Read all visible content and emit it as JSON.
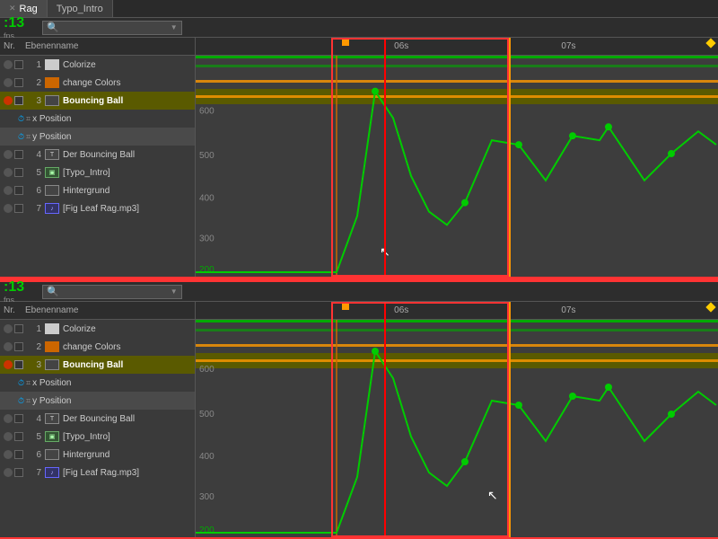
{
  "tabs": [
    {
      "id": "rag",
      "label": "Rag",
      "active": true
    },
    {
      "id": "typo_intro",
      "label": "Typo_Intro",
      "active": false
    }
  ],
  "panel1": {
    "time": ":13",
    "fps": "fps",
    "search_placeholder": "🔍",
    "header": {
      "nr": "Nr.",
      "name": "Ebenenname"
    },
    "layers": [
      {
        "nr": "1",
        "name": "Colorize",
        "icon": "white",
        "selected": false
      },
      {
        "nr": "2",
        "name": "change Colors",
        "icon": "orange",
        "selected": false
      },
      {
        "nr": "3",
        "name": "Bouncing Ball",
        "icon": "dark",
        "selected": true,
        "highlighted": true
      },
      {
        "sub": true,
        "icon": "stopwatch",
        "transform": "x Position"
      },
      {
        "sub": true,
        "icon": "stopwatch",
        "transform": "y Position"
      },
      {
        "nr": "4",
        "name": "Der Bouncing Ball",
        "icon": "text"
      },
      {
        "nr": "5",
        "name": "[Typo_Intro]",
        "icon": "comp"
      },
      {
        "nr": "6",
        "name": "Hintergrund",
        "icon": "dark"
      },
      {
        "nr": "7",
        "name": "[Fig Leaf Rag.mp3]",
        "icon": "audio"
      }
    ],
    "ruler": {
      "labels": [
        {
          "text": "06s",
          "pos": 42
        },
        {
          "text": "07s",
          "pos": 72
        }
      ]
    }
  },
  "panel2": {
    "time": ":13",
    "fps": "fps",
    "search_placeholder": "🔍",
    "header": {
      "nr": "Nr.",
      "name": "Ebenenname"
    },
    "layers": [
      {
        "nr": "1",
        "name": "Colorize",
        "icon": "white",
        "selected": false
      },
      {
        "nr": "2",
        "name": "change Colors",
        "icon": "orange",
        "selected": false
      },
      {
        "nr": "3",
        "name": "Bouncing Ball",
        "icon": "dark",
        "selected": true,
        "highlighted": true
      },
      {
        "sub": true,
        "icon": "stopwatch",
        "transform": "x Position"
      },
      {
        "sub": true,
        "icon": "stopwatch",
        "transform": "y Position"
      },
      {
        "nr": "4",
        "name": "Der Bouncing Ball",
        "icon": "text"
      },
      {
        "nr": "5",
        "name": "[Typo_Intro]",
        "icon": "comp"
      },
      {
        "nr": "6",
        "name": "Hintergrund",
        "icon": "dark"
      },
      {
        "nr": "7",
        "name": "[Fig Leaf Rag.mp3]",
        "icon": "audio"
      }
    ],
    "ruler": {
      "labels": [
        {
          "text": "06s",
          "pos": 42
        },
        {
          "text": "07s",
          "pos": 72
        }
      ]
    }
  },
  "colors": {
    "green": "#00cc00",
    "orange": "#ff9900",
    "red": "#ff3333",
    "selected_bg": "#6a6a00",
    "highlight_bg": "#555555"
  }
}
